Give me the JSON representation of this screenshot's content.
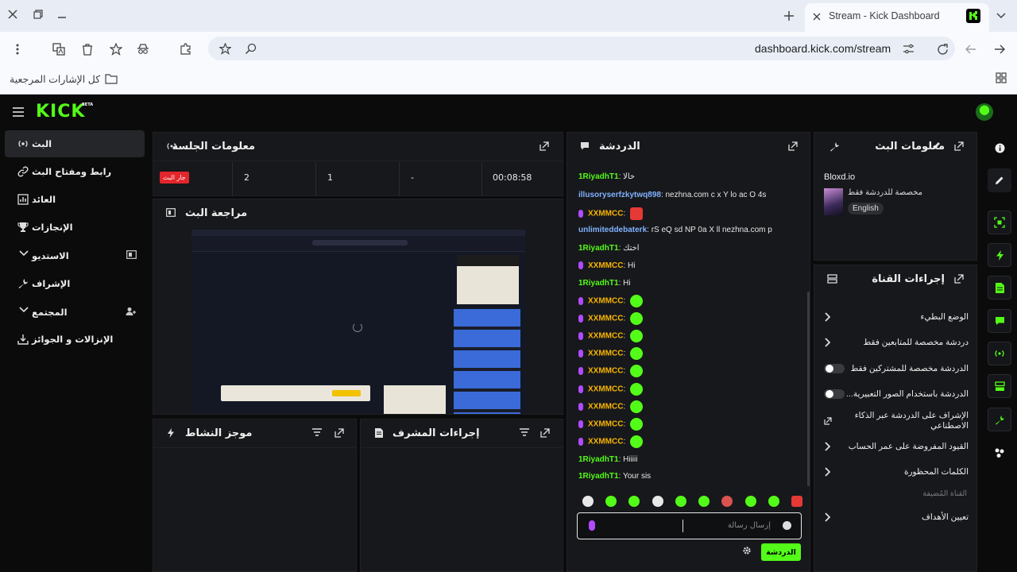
{
  "browser": {
    "tab_title": "Stream - Kick Dashboard",
    "url": "dashboard.kick.com/stream",
    "bookmarks_label": "كل الإشارات المرجعية"
  },
  "app": {
    "logo": "KICK",
    "logo_badge": "BETA"
  },
  "sidebar": {
    "items": [
      {
        "label": "البث"
      },
      {
        "label": "رابط ومفتاح البث"
      },
      {
        "label": "العائد"
      },
      {
        "label": "الإنجازات"
      },
      {
        "label": "الاستديو"
      },
      {
        "label": "الإشراف"
      },
      {
        "label": "المجتمع"
      },
      {
        "label": "الإنزالات و الجوائز"
      }
    ]
  },
  "session": {
    "title": "معلومات الجلسة",
    "live_badge": "جار البث",
    "stats": [
      "2",
      "1",
      "-",
      "00:08:58"
    ]
  },
  "preview": {
    "title": "مراجعة البث"
  },
  "activity": {
    "title": "موجز النشاط"
  },
  "mod_actions": {
    "title": "إجراءات المشرف"
  },
  "chat": {
    "title": "الدردشة",
    "messages": [
      {
        "user": "1RiyadhT1",
        "text": "خالا"
      },
      {
        "user": "illusoryserfzkytwq898",
        "text": "nezhna.com c x Y lo ac O 4s"
      },
      {
        "user": "XXMMCC",
        "text": ""
      },
      {
        "user": "unlimiteddebaterk",
        "text": "rS eQ sd NP 0a X ll nezhna.com p"
      },
      {
        "user": "1RiyadhT1",
        "text": "اختك"
      },
      {
        "user": "XXMMCC",
        "text": "Hi"
      },
      {
        "user": "1RiyadhT1",
        "text": "Hi"
      },
      {
        "user": "XXMMCC",
        "text": ""
      },
      {
        "user": "XXMMCC",
        "text": ""
      },
      {
        "user": "XXMMCC",
        "text": ""
      },
      {
        "user": "XXMMCC",
        "text": ""
      },
      {
        "user": "XXMMCC",
        "text": ""
      },
      {
        "user": "XXMMCC",
        "text": ""
      },
      {
        "user": "XXMMCC",
        "text": ""
      },
      {
        "user": "XXMMCC",
        "text": ""
      },
      {
        "user": "XXMMCC",
        "text": ""
      },
      {
        "user": "1RiyadhT1",
        "text": "Hiiiii"
      },
      {
        "user": "1RiyadhT1",
        "text": "Your sis"
      }
    ],
    "input_placeholder": "إرسال رسالة",
    "send_label": "الدردشة"
  },
  "stream_info": {
    "title": "معلومات البث",
    "stream_title": "Bloxd.io",
    "subtitle": "مخصصة للدردشة فقط",
    "language": "English"
  },
  "channel_actions": {
    "title": "إجراءات القناة",
    "items": [
      {
        "label": "الوضع البطيء"
      },
      {
        "label": "دردشة مخصصة للمتابعين فقط"
      },
      {
        "label": "الدردشة مخصصة للمشتركين فقط"
      },
      {
        "label": "الدردشة باستخدام الصور التعبيرية..."
      },
      {
        "label": "الإشراف على الدردشة عبر الذكاء الاصطناعي"
      },
      {
        "label": "القيود المفروضة على عمر الحساب"
      },
      {
        "label": "الكلمات المحظورة"
      }
    ],
    "section_label": "القناة المُضيفة",
    "goals_label": "تعيين الأهداف"
  },
  "colors": {
    "accent": "#53fc18",
    "live": "#e3262b"
  }
}
